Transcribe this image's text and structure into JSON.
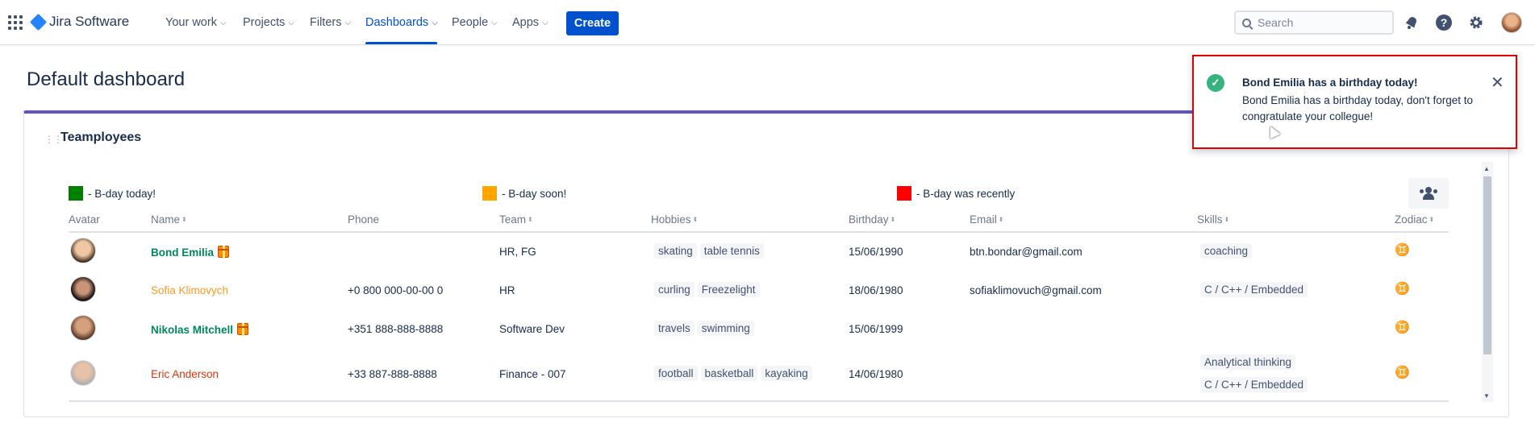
{
  "nav": {
    "brand": "Jira Software",
    "items": [
      "Your work",
      "Projects",
      "Filters",
      "Dashboards",
      "People",
      "Apps"
    ],
    "create": "Create",
    "search_placeholder": "Search"
  },
  "page": {
    "title": "Default dashboard"
  },
  "gadget": {
    "title": "Teamployees",
    "legend": [
      "- B-day today!",
      "- B-day soon!",
      "- B-day was recently"
    ],
    "legend_colors": [
      "#008000",
      "#ffa500",
      "#ff0000"
    ],
    "columns": [
      "Avatar",
      "Name",
      "Phone",
      "Team",
      "Hobbies",
      "Birthday",
      "Email",
      "Skills",
      "Zodiac"
    ],
    "rows": [
      {
        "name": "Bond Emilia",
        "phone": "",
        "team": "HR, FG",
        "hobbies": [
          "skating",
          "table tennis"
        ],
        "birthday": "15/06/1990",
        "email": "btn.bondar@gmail.com",
        "skills": [
          "coaching"
        ],
        "zodiac": "♊"
      },
      {
        "name": "Sofia Klimovych",
        "phone": "+0 800 000-00-00 0",
        "team": "HR",
        "hobbies": [
          "curling",
          "Freezelight"
        ],
        "birthday": "18/06/1980",
        "email": "sofiaklimovuch@gmail.com",
        "skills": [
          "C / C++ / Embedded"
        ],
        "zodiac": "♊"
      },
      {
        "name": "Nikolas Mitchell",
        "phone": "+351 888-888-8888",
        "team": "Software Dev",
        "hobbies": [
          "travels",
          "swimming"
        ],
        "birthday": "15/06/1999",
        "email": "",
        "skills": [],
        "zodiac": "♊"
      },
      {
        "name": "Eric Anderson",
        "phone": "+33 887-888-8888",
        "team": "Finance - 007",
        "hobbies": [
          "football",
          "basketball",
          "kayaking"
        ],
        "birthday": "14/06/1980",
        "email": "",
        "skills": [
          "Analytical thinking",
          "C / C++ / Embedded"
        ],
        "zodiac": "♊"
      }
    ]
  },
  "flag": {
    "title": "Bond Emilia has a birthday today!",
    "body": "Bond Emilia has a birthday today, don't forget to congratulate your collegue!"
  }
}
